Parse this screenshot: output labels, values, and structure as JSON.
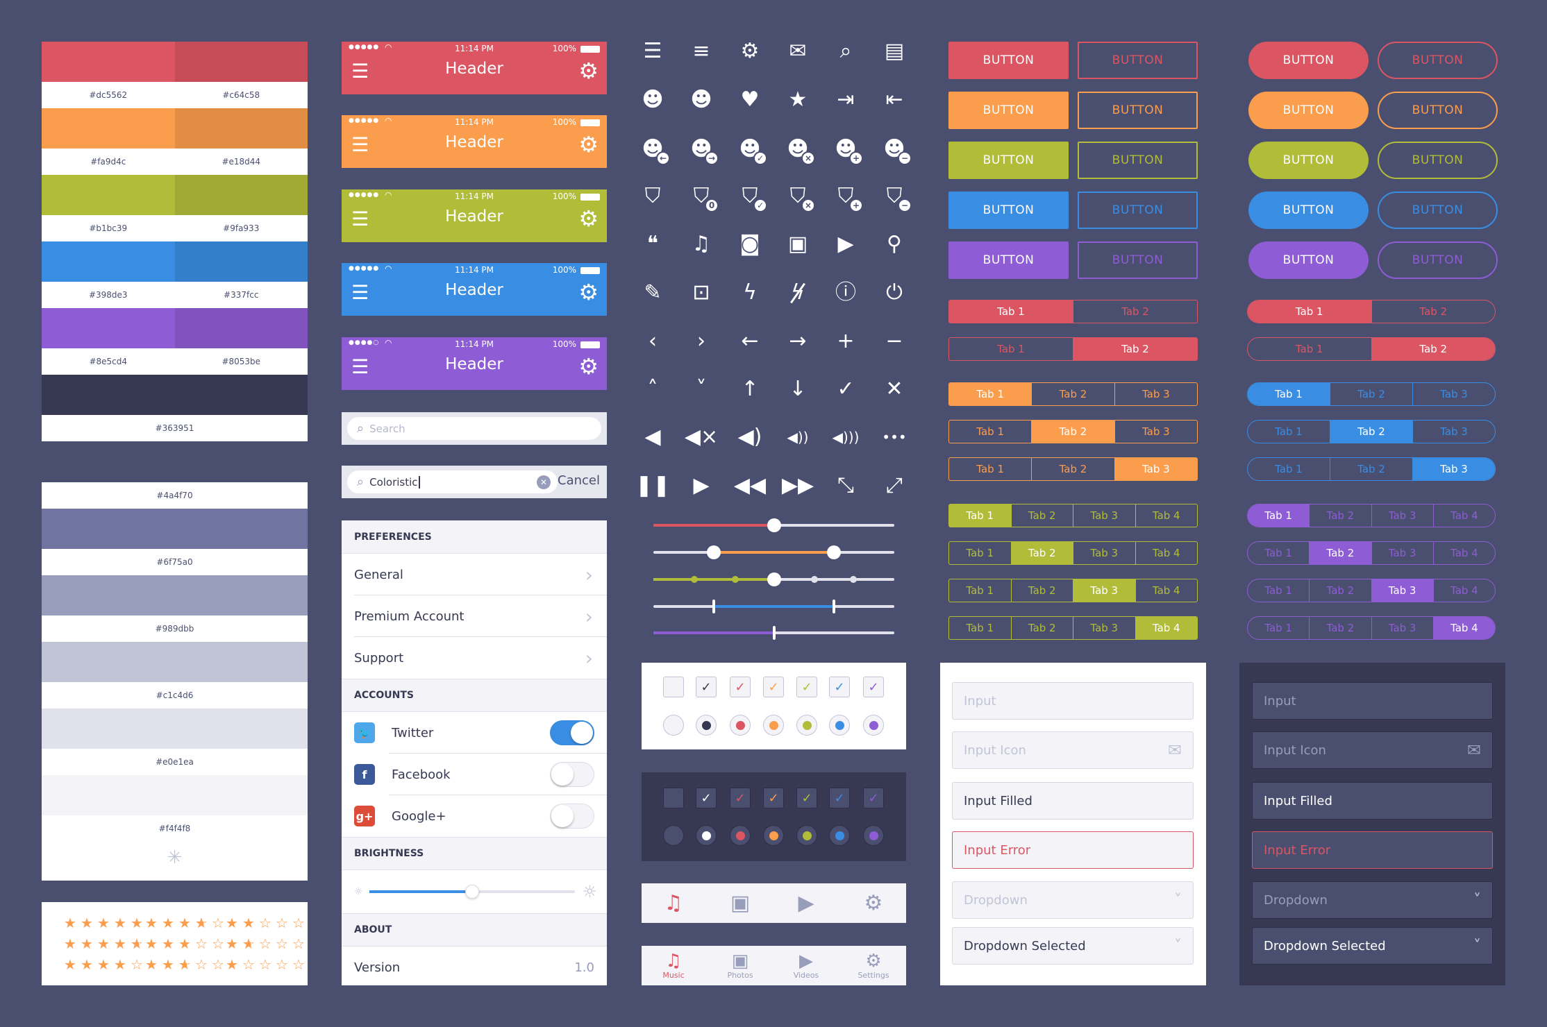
{
  "colors": {
    "background": "#4a4f70",
    "red": "#dc5562",
    "orange": "#fa9d4c",
    "green": "#b1bc39",
    "blue": "#398de3",
    "purple": "#8e5cd4",
    "dark": "#363951",
    "star": "#fa9d4c"
  },
  "palette": {
    "pairs": [
      [
        "#dc5562",
        "#c64c58"
      ],
      [
        "#fa9d4c",
        "#e18d44"
      ],
      [
        "#b1bc39",
        "#9fa933"
      ],
      [
        "#398de3",
        "#337fcc"
      ],
      [
        "#8e5cd4",
        "#8053be"
      ]
    ],
    "dark": "#363951"
  },
  "grays": [
    "#4a4f70",
    "#6f75a0",
    "#989dbb",
    "#c1c4d6",
    "#e0e1ea",
    "#f4f4f8"
  ],
  "ratings": [
    5,
    3.5,
    2,
    4.5,
    3,
    1.5,
    4,
    2.5,
    1
  ],
  "headers": [
    {
      "color": "#dc5562",
      "signal": 5,
      "time": "11:14 PM",
      "battery": "100%",
      "title": "Header"
    },
    {
      "color": "#fa9d4c",
      "signal": 5,
      "time": "11:14 PM",
      "battery": "100%",
      "title": "Header"
    },
    {
      "color": "#b1bc39",
      "signal": 5,
      "time": "11:14 PM",
      "battery": "100%",
      "title": "Header"
    },
    {
      "color": "#398de3",
      "signal": 5,
      "time": "11:14 PM",
      "battery": "100%",
      "title": "Header"
    },
    {
      "color": "#8e5cd4",
      "signal": 4,
      "time": "11:14 PM",
      "battery": "100%",
      "title": "Header"
    }
  ],
  "search": {
    "placeholder": "Search",
    "active_value": "Coloristic",
    "cancel_label": "Cancel"
  },
  "settings": {
    "preferences_title": "PREFERENCES",
    "preferences": [
      "General",
      "Premium Account",
      "Support"
    ],
    "accounts_title": "ACCOUNTS",
    "accounts": [
      {
        "label": "Twitter",
        "icon": "twitter-icon",
        "color": "#4da7ea",
        "glyph": "🐦",
        "enabled": true
      },
      {
        "label": "Facebook",
        "icon": "facebook-icon",
        "color": "#3b5998",
        "glyph": "f",
        "enabled": false
      },
      {
        "label": "Google+",
        "icon": "google-plus-icon",
        "color": "#dd4b39",
        "glyph": "g+",
        "enabled": false
      }
    ],
    "brightness_title": "BRIGHTNESS",
    "brightness": 0.5,
    "about_title": "ABOUT",
    "version_label": "Version",
    "version_value": "1.0"
  },
  "icons": [
    [
      "menu",
      "list",
      "gear",
      "mail",
      "search",
      "contacts"
    ],
    [
      "user",
      "users",
      "heart",
      "star",
      "login",
      "logout"
    ],
    [
      "user-back",
      "user-forward",
      "user-check",
      "user-remove-x",
      "user-add",
      "user-minus"
    ],
    [
      "bag",
      "bag-count",
      "bag-check",
      "bag-remove",
      "bag-add",
      "bag-minus"
    ],
    [
      "chat",
      "music",
      "camera",
      "image",
      "video",
      "location-pin"
    ],
    [
      "edit",
      "lock",
      "flash",
      "flash-off",
      "alert",
      "power"
    ],
    [
      "chevron-left",
      "chevron-right",
      "arrow-left",
      "arrow-right",
      "plus",
      "minus"
    ],
    [
      "chevron-up",
      "chevron-down",
      "arrow-up",
      "arrow-down",
      "check",
      "close"
    ],
    [
      "speaker",
      "mute",
      "volume-low",
      "volume-medium",
      "volume-high",
      "more"
    ],
    [
      "pause",
      "play",
      "rewind",
      "fast-forward",
      "shrink",
      "expand"
    ]
  ],
  "sliders": [
    {
      "type": "single",
      "color": "#dc5562",
      "value": 0.5
    },
    {
      "type": "range",
      "color": "#fa9d4c",
      "values": [
        0.25,
        0.75
      ]
    },
    {
      "type": "stepped",
      "color": "#b1bc39",
      "value": 0.5,
      "steps": [
        0,
        0.17,
        0.34,
        0.5,
        0.67,
        0.83,
        1
      ]
    },
    {
      "type": "range-ticks",
      "color": "#398de3",
      "values": [
        0.25,
        0.75
      ]
    },
    {
      "type": "single-tick",
      "color": "#8e5cd4",
      "value": 0.5
    }
  ],
  "checkboxes": {
    "colors": [
      "#363951",
      "#dc5562",
      "#fa9d4c",
      "#b1bc39",
      "#398de3",
      "#8e5cd4"
    ],
    "dark_colors": [
      "#ffffff",
      "#dc5562",
      "#fa9d4c",
      "#b1bc39",
      "#398de3",
      "#8e5cd4"
    ]
  },
  "tabbar": {
    "items": [
      {
        "label": "Music",
        "icon": "music-icon",
        "glyph": "♫"
      },
      {
        "label": "Photos",
        "icon": "image-icon",
        "glyph": "▣"
      },
      {
        "label": "Videos",
        "icon": "video-icon",
        "glyph": "▶"
      },
      {
        "label": "Settings",
        "icon": "gear-icon",
        "glyph": "⚙"
      }
    ],
    "active": 0,
    "active_color": "#dc5562",
    "inactive_color": "#989dbb"
  },
  "buttons": {
    "label": "BUTTON",
    "colors": [
      "#dc5562",
      "#fa9d4c",
      "#b1bc39",
      "#398de3",
      "#8e5cd4"
    ]
  },
  "tab_groups": {
    "square": [
      {
        "color": "#dc5562",
        "labels": [
          "Tab 1",
          "Tab 2"
        ],
        "active": 0
      },
      {
        "color": "#dc5562",
        "labels": [
          "Tab 1",
          "Tab 2"
        ],
        "active": 1
      },
      {
        "color": "#fa9d4c",
        "labels": [
          "Tab 1",
          "Tab 2",
          "Tab 3"
        ],
        "active": 0
      },
      {
        "color": "#fa9d4c",
        "labels": [
          "Tab 1",
          "Tab 2",
          "Tab 3"
        ],
        "active": 1
      },
      {
        "color": "#fa9d4c",
        "labels": [
          "Tab 1",
          "Tab 2",
          "Tab 3"
        ],
        "active": 2
      },
      {
        "color": "#b1bc39",
        "labels": [
          "Tab 1",
          "Tab 2",
          "Tab 3",
          "Tab 4"
        ],
        "active": 0
      },
      {
        "color": "#b1bc39",
        "labels": [
          "Tab 1",
          "Tab 2",
          "Tab 3",
          "Tab 4"
        ],
        "active": 1
      },
      {
        "color": "#b1bc39",
        "labels": [
          "Tab 1",
          "Tab 2",
          "Tab 3",
          "Tab 4"
        ],
        "active": 2
      },
      {
        "color": "#b1bc39",
        "labels": [
          "Tab 1",
          "Tab 2",
          "Tab 3",
          "Tab 4"
        ],
        "active": 3
      }
    ],
    "pill": [
      {
        "color": "#dc5562",
        "labels": [
          "Tab 1",
          "Tab 2"
        ],
        "active": 0
      },
      {
        "color": "#dc5562",
        "labels": [
          "Tab 1",
          "Tab 2"
        ],
        "active": 1
      },
      {
        "color": "#398de3",
        "labels": [
          "Tab 1",
          "Tab 2",
          "Tab 3"
        ],
        "active": 0
      },
      {
        "color": "#398de3",
        "labels": [
          "Tab 1",
          "Tab 2",
          "Tab 3"
        ],
        "active": 1
      },
      {
        "color": "#398de3",
        "labels": [
          "Tab 1",
          "Tab 2",
          "Tab 3"
        ],
        "active": 2
      },
      {
        "color": "#8e5cd4",
        "labels": [
          "Tab 1",
          "Tab 2",
          "Tab 3",
          "Tab 4"
        ],
        "active": 0
      },
      {
        "color": "#8e5cd4",
        "labels": [
          "Tab 1",
          "Tab 2",
          "Tab 3",
          "Tab 4"
        ],
        "active": 1
      },
      {
        "color": "#8e5cd4",
        "labels": [
          "Tab 1",
          "Tab 2",
          "Tab 3",
          "Tab 4"
        ],
        "active": 2
      },
      {
        "color": "#8e5cd4",
        "labels": [
          "Tab 1",
          "Tab 2",
          "Tab 3",
          "Tab 4"
        ],
        "active": 3
      }
    ]
  },
  "forms": [
    {
      "text": "Input",
      "state": "placeholder"
    },
    {
      "text": "Input Icon",
      "state": "placeholder",
      "icon": "mail-icon"
    },
    {
      "text": "Input Filled",
      "state": "filled"
    },
    {
      "text": "Input Error",
      "state": "error"
    },
    {
      "text": "Dropdown",
      "state": "placeholder",
      "dropdown": true
    },
    {
      "text": "Dropdown Selected",
      "state": "filled",
      "dropdown": true
    }
  ]
}
